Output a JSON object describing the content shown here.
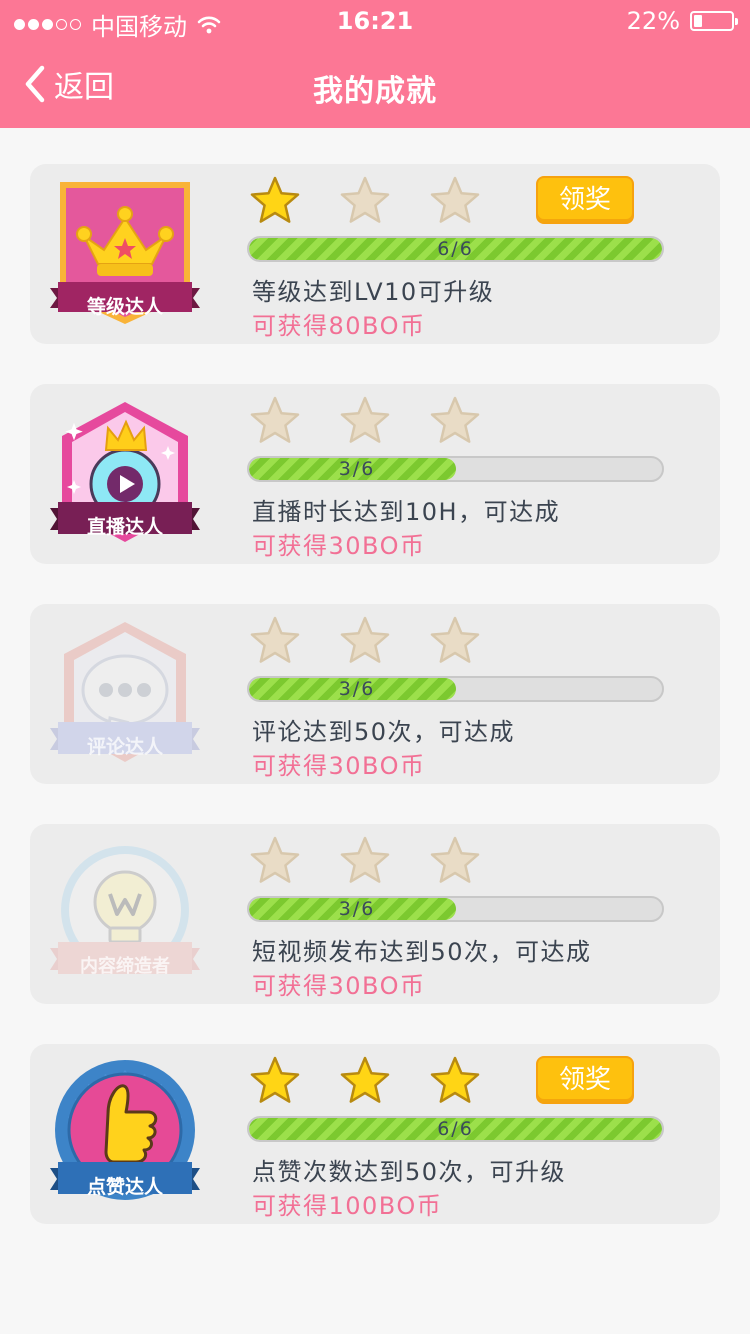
{
  "status_bar": {
    "carrier": "中国移动",
    "time": "16:21",
    "battery": "22%",
    "battery_level": 0.22
  },
  "nav": {
    "back_label": "返回",
    "title": "我的成就"
  },
  "claim_label": "领奖",
  "achievements": [
    {
      "badge_label": "等级达人",
      "badge_icon": "crown-badge-icon",
      "stars_earned": 1,
      "stars_total": 3,
      "progress": 6,
      "progress_max": 6,
      "progress_text": "6/6",
      "description": "等级达到LV10可升级",
      "reward": "可获得80BO币",
      "claimable": true,
      "dimmed": false
    },
    {
      "badge_label": "直播达人",
      "badge_icon": "live-play-badge-icon",
      "stars_earned": 0,
      "stars_total": 3,
      "progress": 3,
      "progress_max": 6,
      "progress_text": "3/6",
      "description": "直播时长达到10H，可达成",
      "reward": "可获得30BO币",
      "claimable": false,
      "dimmed": false
    },
    {
      "badge_label": "评论达人",
      "badge_icon": "comment-badge-icon",
      "stars_earned": 0,
      "stars_total": 3,
      "progress": 3,
      "progress_max": 6,
      "progress_text": "3/6",
      "description": "评论达到50次，可达成",
      "reward": "可获得30BO币",
      "claimable": false,
      "dimmed": true
    },
    {
      "badge_label": "内容缔造者",
      "badge_icon": "lightbulb-badge-icon",
      "stars_earned": 0,
      "stars_total": 3,
      "progress": 3,
      "progress_max": 6,
      "progress_text": "3/6",
      "description": "短视频发布达到50次，可达成",
      "reward": "可获得30BO币",
      "claimable": false,
      "dimmed": true
    },
    {
      "badge_label": "点赞达人",
      "badge_icon": "thumbs-up-badge-icon",
      "stars_earned": 3,
      "stars_total": 3,
      "progress": 6,
      "progress_max": 6,
      "progress_text": "6/6",
      "description": "点赞次数达到50次，可升级",
      "reward": "可获得100BO币",
      "claimable": true,
      "dimmed": false
    }
  ],
  "colors": {
    "header": "#fc7795",
    "reward": "#f27095",
    "claim_button": "#fec10e",
    "progress_fill": "#9ce04b",
    "star_gold": "#ffd515",
    "star_empty": "#e9dcc6"
  }
}
